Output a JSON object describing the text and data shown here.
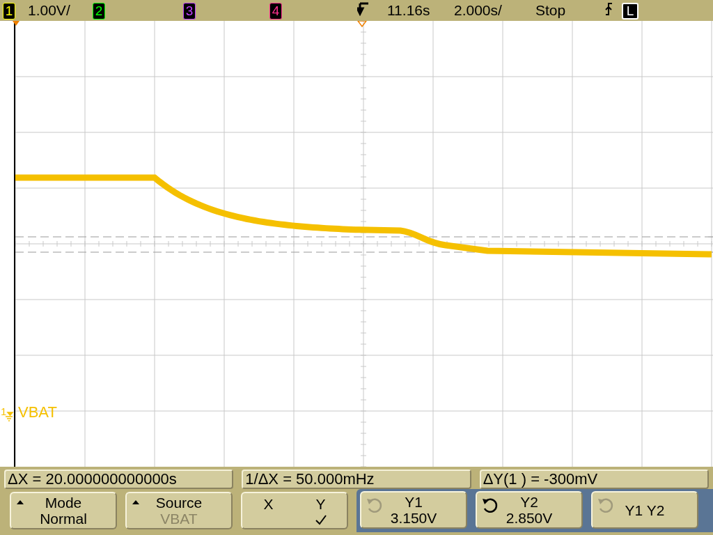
{
  "top_bar": {
    "channels": [
      {
        "label": "1",
        "color": "#ffff00",
        "scale": "1.00V/"
      },
      {
        "label": "2",
        "color": "#00ff00"
      },
      {
        "label": "3",
        "color": "#c040ff"
      },
      {
        "label": "4",
        "color": "#ff3090"
      }
    ],
    "trigger_position": "11.16s",
    "time_scale": "2.000s/",
    "run_state": "Stop",
    "trigger_mode": "L"
  },
  "waveform": {
    "channel": "1",
    "label": "VBAT",
    "color": "#f5c000"
  },
  "readouts": [
    "ΔX = 20.000000000000s",
    "1/ΔX = 50.000mHz",
    "ΔY(1 ) = -300mV"
  ],
  "softkeys": [
    {
      "kind": "menu",
      "title": "Mode",
      "value": "Normal",
      "dimmed": false
    },
    {
      "kind": "menu",
      "title": "Source",
      "value": "VBAT",
      "dimmed": true
    },
    {
      "kind": "choice",
      "options": [
        {
          "label": "X",
          "selected": false
        },
        {
          "label": "Y",
          "selected": true
        }
      ]
    },
    {
      "kind": "cursor",
      "title": "Y1",
      "value": "3.150V",
      "active": false
    },
    {
      "kind": "cursor",
      "title": "Y2",
      "value": "2.850V",
      "active": true
    },
    {
      "kind": "cursor",
      "title": "Y1 Y2",
      "active": false
    }
  ]
}
